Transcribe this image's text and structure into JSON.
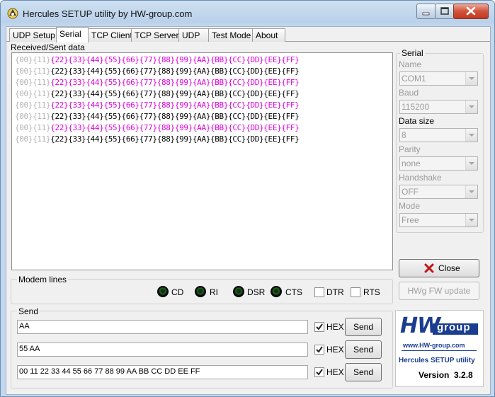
{
  "window": {
    "title": "Hercules SETUP utility by HW-group.com"
  },
  "tabs": [
    {
      "label": "UDP Setup"
    },
    {
      "label": "Serial"
    },
    {
      "label": "TCP Client"
    },
    {
      "label": "TCP Server"
    },
    {
      "label": "UDP"
    },
    {
      "label": "Test Mode"
    },
    {
      "label": "About"
    }
  ],
  "received": {
    "label": "Received/Sent data",
    "rows": [
      {
        "prefix": "{00}{11}",
        "data": "{22}{33}{44}{55}{66}{77}{88}{99}{AA}{BB}{CC}{DD}{EE}{FF}",
        "kind": "sent"
      },
      {
        "prefix": "{00}{11}",
        "data": "{22}{33}{44}{55}{66}{77}{88}{99}{AA}{BB}{CC}{DD}{EE}{FF}",
        "kind": "received"
      },
      {
        "prefix": "{00}{11}",
        "data": "{22}{33}{44}{55}{66}{77}{88}{99}{AA}{BB}{CC}{DD}{EE}{FF}",
        "kind": "sent"
      },
      {
        "prefix": "{00}{11}",
        "data": "{22}{33}{44}{55}{66}{77}{88}{99}{AA}{BB}{CC}{DD}{EE}{FF}",
        "kind": "received"
      },
      {
        "prefix": "{00}{11}",
        "data": "{22}{33}{44}{55}{66}{77}{88}{99}{AA}{BB}{CC}{DD}{EE}{FF}",
        "kind": "sent"
      },
      {
        "prefix": "{00}{11}",
        "data": "{22}{33}{44}{55}{66}{77}{88}{99}{AA}{BB}{CC}{DD}{EE}{FF}",
        "kind": "received"
      },
      {
        "prefix": "{00}{11}",
        "data": "{22}{33}{44}{55}{66}{77}{88}{99}{AA}{BB}{CC}{DD}{EE}{FF}",
        "kind": "sent"
      },
      {
        "prefix": "{00}{11}",
        "data": "{22}{33}{44}{55}{66}{77}{88}{99}{AA}{BB}{CC}{DD}{EE}{FF}",
        "kind": "received"
      }
    ]
  },
  "serial": {
    "title": "Serial",
    "name_label": "Name",
    "name_value": "COM1",
    "baud_label": "Baud",
    "baud_value": "115200",
    "datasize_label": "Data size",
    "datasize_value": "8",
    "parity_label": "Parity",
    "parity_value": "none",
    "handshake_label": "Handshake",
    "handshake_value": "OFF",
    "mode_label": "Mode",
    "mode_value": "Free",
    "close_label": "Close",
    "fw_label": "HWg FW update"
  },
  "modem": {
    "title": "Modem lines",
    "cd": "CD",
    "ri": "RI",
    "dsr": "DSR",
    "cts": "CTS",
    "dtr": "DTR",
    "rts": "RTS"
  },
  "send": {
    "title": "Send",
    "rows": [
      {
        "value": "AA",
        "hex_label": "HEX",
        "button": "Send"
      },
      {
        "value": "55 AA",
        "hex_label": "HEX",
        "button": "Send"
      },
      {
        "value": "00 11 22 33 44 55 66 77 88 99 AA BB CC DD EE FF",
        "hex_label": "HEX",
        "button": "Send"
      }
    ]
  },
  "logo": {
    "hw": "HW",
    "group": "group",
    "url": "www.HW-group.com",
    "product": "Hercules SETUP utility",
    "version": "Version  3.2.8"
  },
  "colors": {
    "sent": "#e000e0",
    "received": "#000000",
    "prefix": "#b3b3b3",
    "logo_blue": "#1b3d8f"
  }
}
